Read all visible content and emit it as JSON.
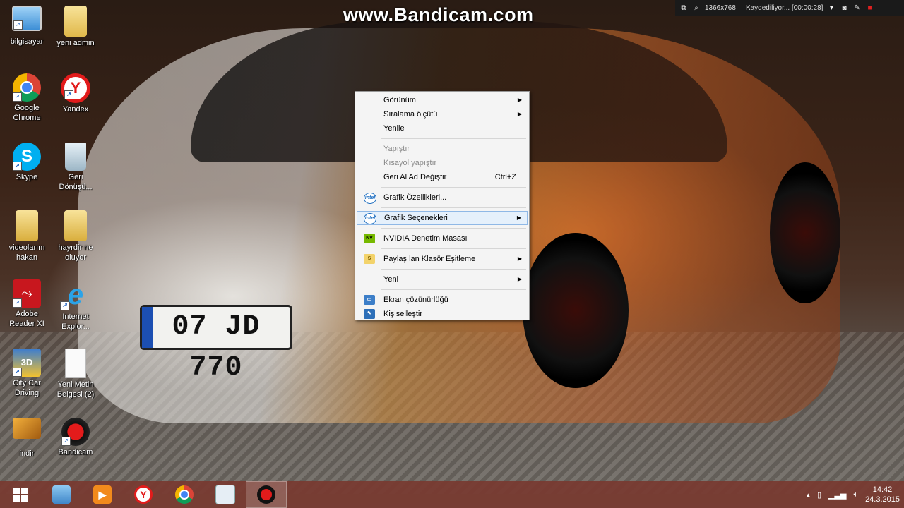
{
  "watermark": "www.Bandicam.com",
  "bandicam": {
    "resolution": "1366x768",
    "status": "Kaydediliyor... [00:00:28]"
  },
  "desktop_icons": [
    {
      "label": "bilgisayar",
      "icon": "computer-icon"
    },
    {
      "label": "yeni admin",
      "icon": "user-folder-icon"
    },
    {
      "label": "Google\nChrome",
      "icon": "chrome-icon"
    },
    {
      "label": "Yandex",
      "icon": "yandex-icon"
    },
    {
      "label": "Skype",
      "icon": "skype-icon"
    },
    {
      "label": "Geri\nDönüşü...",
      "icon": "recycle-bin-icon"
    },
    {
      "label": "videolarım\nhakan",
      "icon": "folder-icon"
    },
    {
      "label": "hayrdir ne\noluyor",
      "icon": "folder-icon"
    },
    {
      "label": "Adobe\nReader XI",
      "icon": "adobe-reader-icon"
    },
    {
      "label": "Internet\nExplor...",
      "icon": "internet-explorer-icon"
    },
    {
      "label": "City Car\nDriving",
      "icon": "city-car-driving-icon"
    },
    {
      "label": "Yeni Metin\nBelgesi (2)",
      "icon": "text-document-icon"
    },
    {
      "label": "indir",
      "icon": "image-file-icon"
    },
    {
      "label": "Bandicam",
      "icon": "bandicam-icon"
    }
  ],
  "context_menu": {
    "view": "Görünüm",
    "sort": "Sıralama ölçütü",
    "refresh": "Yenile",
    "paste": "Yapıştır",
    "paste_shortcut": "Kısayol yapıştır",
    "undo": "Geri Al Ad Değiştir",
    "undo_accel": "Ctrl+Z",
    "graphics_props": "Grafik Özellikleri...",
    "graphics_options": "Grafik Seçenekleri",
    "nvidia": "NVIDIA Denetim Masası",
    "shared_folder_sync": "Paylaşılan Klasör Eşitleme",
    "new": "Yeni",
    "screen_resolution": "Ekran çözünürlüğü",
    "personalize": "Kişiselleştir"
  },
  "taskbar": {
    "time": "14:42",
    "date": "24.3.2015"
  },
  "car_plate": "07 JD 770"
}
